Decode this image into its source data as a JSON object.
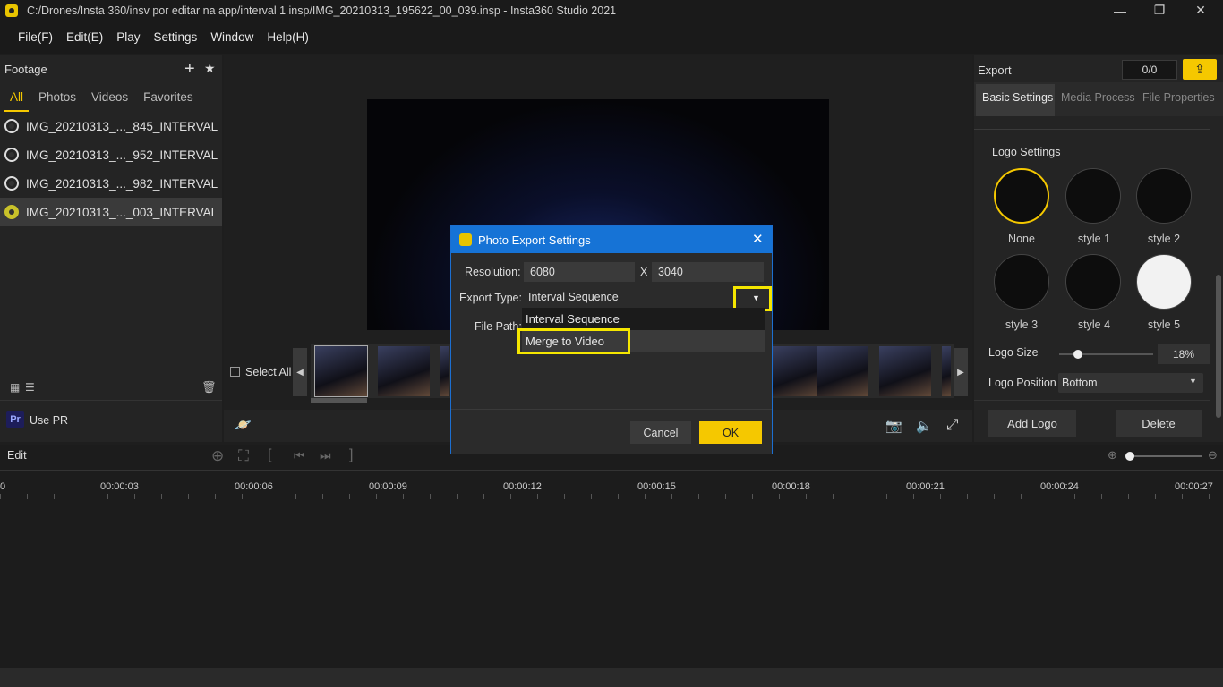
{
  "window": {
    "title": "C:/Drones/Insta 360/insv por editar na app/interval 1 insp/IMG_20210313_195622_00_039.insp - Insta360 Studio 2021",
    "minimize": "—",
    "restore": "❐",
    "close": "✕"
  },
  "menu": [
    "File(F)",
    "Edit(E)",
    "Play",
    "Settings",
    "Window",
    "Help(H)"
  ],
  "footage": {
    "title": "Footage",
    "tabs": [
      "All",
      "Photos",
      "Videos",
      "Favorites"
    ],
    "active_tab": "All",
    "files": [
      "IMG_20210313_..._845_INTERVAL",
      "IMG_20210313_..._952_INTERVAL",
      "IMG_20210313_..._982_INTERVAL",
      "IMG_20210313_..._003_INTERVAL"
    ],
    "selected_index": 3,
    "use_pr": "Use PR",
    "pr_badge": "Pr"
  },
  "preview": {
    "select_all": "Select All"
  },
  "export_panel": {
    "title": "Export",
    "count": "0/0",
    "tabs": [
      "Basic Settings",
      "Media Process",
      "File Properties"
    ],
    "logo_settings": "Logo Settings",
    "logos": [
      "None",
      "style 1",
      "style 2",
      "style 3",
      "style 4",
      "style 5"
    ],
    "logo_size_label": "Logo Size",
    "logo_size_value": "18%",
    "logo_size_fraction": 0.18,
    "logo_position_label": "Logo Position",
    "logo_position_value": "Bottom",
    "add_logo": "Add Logo",
    "delete": "Delete"
  },
  "timeline": {
    "title": "Edit",
    "ticks": [
      "0",
      "00:00:03",
      "00:00:06",
      "00:00:09",
      "00:00:12",
      "00:00:15",
      "00:00:18",
      "00:00:21",
      "00:00:24",
      "00:00:27"
    ]
  },
  "dialog": {
    "title": "Photo Export Settings",
    "resolution_label": "Resolution:",
    "res_width": "6080",
    "res_x": "X",
    "res_height": "3040",
    "export_type_label": "Export Type:",
    "export_type_value": "Interval Sequence",
    "file_path_label": "File Path:",
    "options": [
      "Interval Sequence",
      "Merge to Video"
    ],
    "cancel": "Cancel",
    "ok": "OK",
    "highlight_color": "#f5e600"
  }
}
